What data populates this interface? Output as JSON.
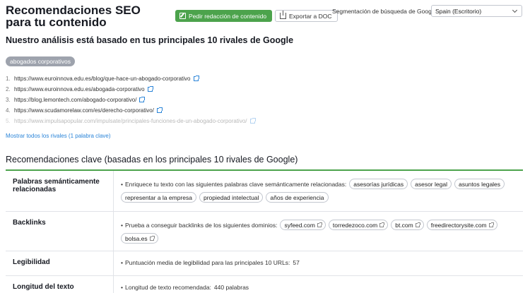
{
  "header": {
    "title": "Recomendaciones SEO para tu contenido",
    "order_button": "Pedir redacción de contenido",
    "export_button": "Exportar a DOC",
    "segmentation_label": "Segmentación de búsqueda de Google:",
    "segmentation_value": "Spain (Escritorio)"
  },
  "analysis": {
    "subtitle": "Nuestro análisis está basado en tus principales 10 rivales de Google",
    "keyword": "abogados corporativos",
    "urls": [
      {
        "num": "1.",
        "url": "https://www.euroinnova.edu.es/blog/que-hace-un-abogado-corporativo"
      },
      {
        "num": "2.",
        "url": "https://www.euroinnova.edu.es/abogada-corporativo"
      },
      {
        "num": "3.",
        "url": "https://blog.lemontech.com/abogado-corporativo/"
      },
      {
        "num": "4.",
        "url": "https://www.scudamorelaw.com/es/derecho-corporativo/"
      },
      {
        "num": "5.",
        "url": "https://www.impulsapopular.com/impulsate/principales-funciones-de-un-abogado-corporativo/"
      }
    ],
    "show_all": "Mostrar todos los rivales (1 palabra clave)"
  },
  "recommendations": {
    "title": "Recomendaciones clave (basadas en los principales 10 rivales de Google)",
    "semantic": {
      "label": "Palabras semánticamente relacionadas",
      "text": "Enriquece tu texto con las siguientes palabras clave semánticamente relacionadas:",
      "chips": [
        "asesorías jurídicas",
        "asesor legal",
        "asuntos legales",
        "representar a la empresa",
        "propiedad intelectual",
        "años de experiencia"
      ]
    },
    "backlinks": {
      "label": "Backlinks",
      "text": "Prueba a conseguir backlinks de los siguientes dominios:",
      "chips": [
        "syfeed.com",
        "torredezoco.com",
        "bt.com",
        "freedirectorysite.com",
        "bolsa.es"
      ]
    },
    "readability": {
      "label": "Legibilidad",
      "text": "Puntuación media de legibilidad para las principales 10 URLs:",
      "value": "57"
    },
    "length": {
      "label": "Longitud del texto",
      "text": "Longitud de texto recomendada:",
      "value": "440 palabras"
    }
  }
}
